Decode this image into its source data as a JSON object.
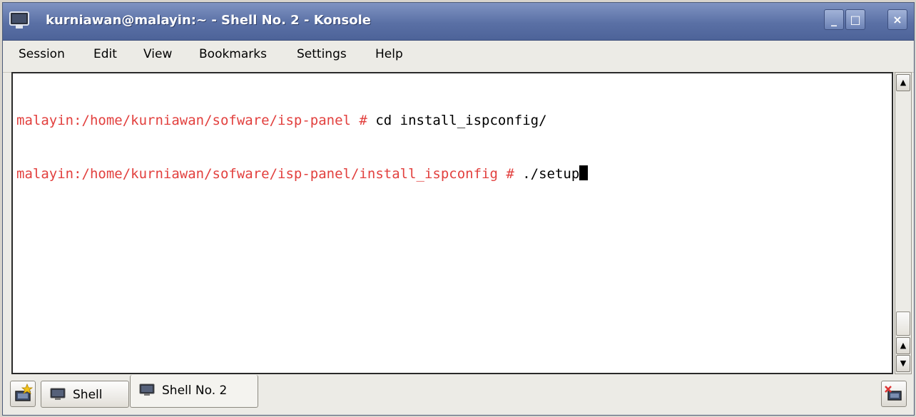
{
  "window": {
    "title": "kurniawan@malayin:~ - Shell No. 2 - Konsole",
    "buttons": {
      "minimize": "_",
      "maximize": "□",
      "close": "×"
    }
  },
  "menu": [
    "Session",
    "Edit",
    "View",
    "Bookmarks",
    "Settings",
    "Help"
  ],
  "terminal": {
    "lines": [
      {
        "prompt": "malayin:/home/kurniawan/sofware/isp-panel #",
        "command": " cd install_ispconfig/"
      },
      {
        "prompt": "malayin:/home/kurniawan/sofware/isp-panel/install_ispconfig #",
        "command": " ./setup"
      }
    ],
    "prompt_color": "#e2403e"
  },
  "tabs": [
    {
      "label": "Shell",
      "active": false
    },
    {
      "label": "Shell No. 2",
      "active": true
    }
  ],
  "icons": {
    "app": "konsole-terminal-icon",
    "new_session": "new-session-icon",
    "close_session": "close-session-icon",
    "tab": "terminal-icon"
  }
}
